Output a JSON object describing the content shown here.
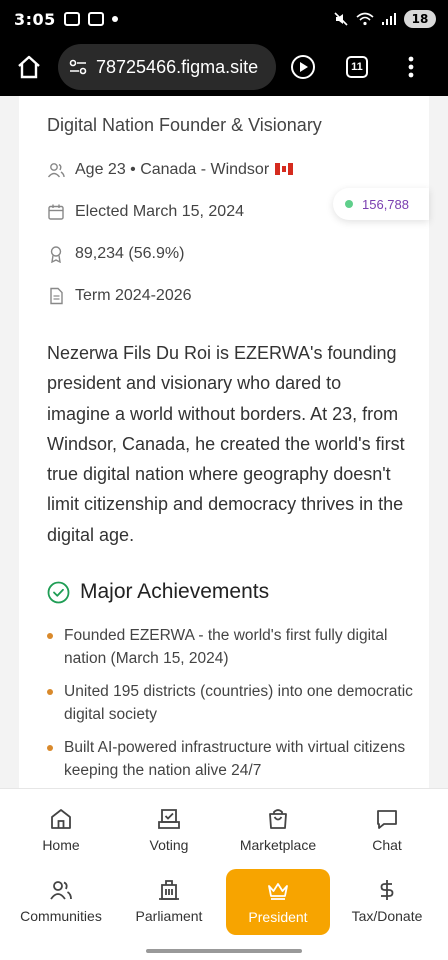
{
  "status_bar": {
    "time": "3:05",
    "battery": "18"
  },
  "browser": {
    "url": "78725466.figma.site",
    "tab_count": "11"
  },
  "profile": {
    "subtitle": "Digital Nation Founder & Visionary",
    "age_location": "Age 23 • Canada - Windsor",
    "elected": "Elected March 15, 2024",
    "votes": "89,234 (56.9%)",
    "term": "Term 2024-2026",
    "live_count": "156,788",
    "bio": "Nezerwa Fils Du Roi is EZERWA's founding president and visionary who dared to imagine a world without borders. At 23, from Windsor, Canada, he created the world's first true digital nation where geography doesn't limit citizenship and democracy thrives in the digital age."
  },
  "achievements": {
    "title": "Major Achievements",
    "items": [
      "Founded EZERWA - the world's first fully digital nation (March 15, 2024)",
      "United 195 districts (countries) into one democratic digital society",
      "Built AI-powered infrastructure with virtual citizens keeping the nation alive 24/7"
    ]
  },
  "nav": {
    "row1": [
      "Home",
      "Voting",
      "Marketplace",
      "Chat"
    ],
    "row2": [
      "Communities",
      "Parliament",
      "President",
      "Tax/Donate"
    ]
  },
  "colors": {
    "accent": "#f7a400",
    "live_dot": "#5fcf8b",
    "bullet": "#d9892b",
    "check": "#1f9d55",
    "votes_text": "#7a3fb0"
  }
}
